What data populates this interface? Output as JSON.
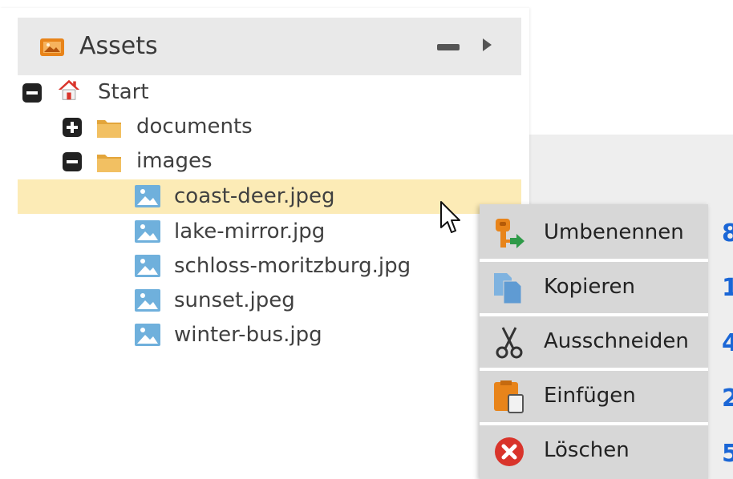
{
  "panel": {
    "title": "Assets",
    "icons": {
      "header": "image-folder-icon",
      "minimize": "minus-icon",
      "expand": "triangle-right-icon"
    }
  },
  "tree": {
    "root": {
      "label": "Start",
      "icon": "home-icon",
      "expanded": true
    },
    "folders": [
      {
        "label": "documents",
        "icon": "folder-icon",
        "expanded": false
      },
      {
        "label": "images",
        "icon": "folder-icon",
        "expanded": true
      }
    ],
    "files": [
      {
        "label": "coast-deer.jpeg",
        "icon": "image-file-icon",
        "selected": true
      },
      {
        "label": "lake-mirror.jpg",
        "icon": "image-file-icon",
        "selected": false
      },
      {
        "label": "schloss-moritzburg.jpg",
        "icon": "image-file-icon",
        "selected": false
      },
      {
        "label": "sunset.jpeg",
        "icon": "image-file-icon",
        "selected": false
      },
      {
        "label": "winter-bus.jpg",
        "icon": "image-file-icon",
        "selected": false
      }
    ]
  },
  "context_menu": {
    "items": [
      {
        "label": "Umbenennen",
        "icon": "rename-key-icon"
      },
      {
        "label": "Kopieren",
        "icon": "copy-icon"
      },
      {
        "label": "Ausschneiden",
        "icon": "scissors-icon"
      },
      {
        "label": "Einfügen",
        "icon": "paste-icon"
      },
      {
        "label": "Löschen",
        "icon": "delete-icon"
      }
    ]
  },
  "side_numbers": [
    "8",
    "1",
    "4",
    "2",
    "5"
  ],
  "colors": {
    "selected_row": "#fcebb6",
    "accent_orange": "#e8841a",
    "side_number": "#1a66d6",
    "file_icon": "#6fb0dc"
  }
}
